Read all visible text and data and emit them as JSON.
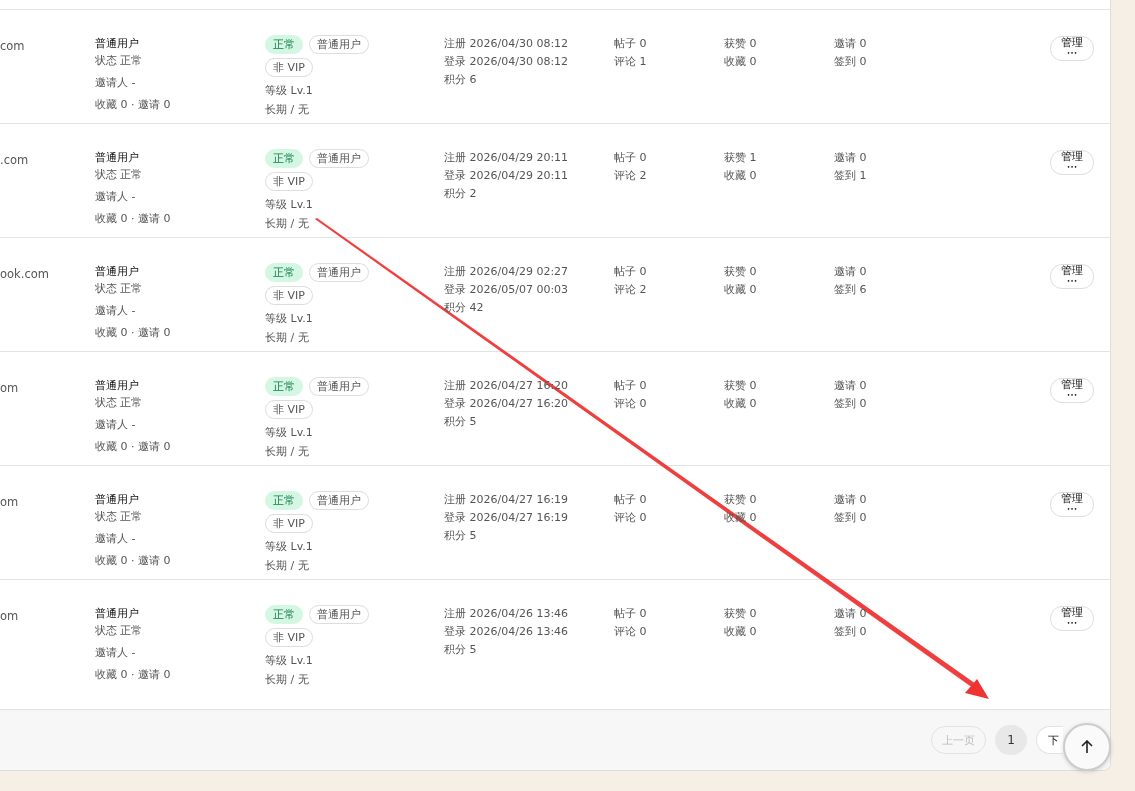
{
  "users": [
    {
      "email": "com",
      "role": "普通用户",
      "status_line": "状态 正常",
      "inviter": "邀请人 -",
      "counts": "收藏 0 · 邀请 0",
      "status_badge": "正常",
      "role_badge": "普通用户",
      "vip_badge": "非 VIP",
      "level": "等级 Lv.1",
      "term": "长期 / 无",
      "registered": "注册 2026/04/30 08:12",
      "login": "登录 2026/04/30 08:12",
      "points": "积分 6",
      "posts": "帖子 0",
      "comments": "评论 1",
      "likes": "获赞 0",
      "favorites": "收藏 0",
      "invites": "邀请 0",
      "checkins": "签到 0",
      "manage": "管理",
      "more": "•••"
    },
    {
      "email": ".com",
      "role": "普通用户",
      "status_line": "状态 正常",
      "inviter": "邀请人 -",
      "counts": "收藏 0 · 邀请 0",
      "status_badge": "正常",
      "role_badge": "普通用户",
      "vip_badge": "非 VIP",
      "level": "等级 Lv.1",
      "term": "长期 / 无",
      "registered": "注册 2026/04/29 20:11",
      "login": "登录 2026/04/29 20:11",
      "points": "积分 2",
      "posts": "帖子 0",
      "comments": "评论 2",
      "likes": "获赞 1",
      "favorites": "收藏 0",
      "invites": "邀请 0",
      "checkins": "签到 1",
      "manage": "管理",
      "more": "•••"
    },
    {
      "email": "ook.com",
      "role": "普通用户",
      "status_line": "状态 正常",
      "inviter": "邀请人 -",
      "counts": "收藏 0 · 邀请 0",
      "status_badge": "正常",
      "role_badge": "普通用户",
      "vip_badge": "非 VIP",
      "level": "等级 Lv.1",
      "term": "长期 / 无",
      "registered": "注册 2026/04/29 02:27",
      "login": "登录 2026/05/07 00:03",
      "points": "积分 42",
      "posts": "帖子 0",
      "comments": "评论 2",
      "likes": "获赞 0",
      "favorites": "收藏 0",
      "invites": "邀请 0",
      "checkins": "签到 6",
      "manage": "管理",
      "more": "•••"
    },
    {
      "email": "om",
      "role": "普通用户",
      "status_line": "状态 正常",
      "inviter": "邀请人 -",
      "counts": "收藏 0 · 邀请 0",
      "status_badge": "正常",
      "role_badge": "普通用户",
      "vip_badge": "非 VIP",
      "level": "等级 Lv.1",
      "term": "长期 / 无",
      "registered": "注册 2026/04/27 16:20",
      "login": "登录 2026/04/27 16:20",
      "points": "积分 5",
      "posts": "帖子 0",
      "comments": "评论 0",
      "likes": "获赞 0",
      "favorites": "收藏 0",
      "invites": "邀请 0",
      "checkins": "签到 0",
      "manage": "管理",
      "more": "•••"
    },
    {
      "email": "om",
      "role": "普通用户",
      "status_line": "状态 正常",
      "inviter": "邀请人 -",
      "counts": "收藏 0 · 邀请 0",
      "status_badge": "正常",
      "role_badge": "普通用户",
      "vip_badge": "非 VIP",
      "level": "等级 Lv.1",
      "term": "长期 / 无",
      "registered": "注册 2026/04/27 16:19",
      "login": "登录 2026/04/27 16:19",
      "points": "积分 5",
      "posts": "帖子 0",
      "comments": "评论 0",
      "likes": "获赞 0",
      "favorites": "收藏 0",
      "invites": "邀请 0",
      "checkins": "签到 0",
      "manage": "管理",
      "more": "•••"
    },
    {
      "email": "om",
      "role": "普通用户",
      "status_line": "状态 正常",
      "inviter": "邀请人 -",
      "counts": "收藏 0 · 邀请 0",
      "status_badge": "正常",
      "role_badge": "普通用户",
      "vip_badge": "非 VIP",
      "level": "等级 Lv.1",
      "term": "长期 / 无",
      "registered": "注册 2026/04/26 13:46",
      "login": "登录 2026/04/26 13:46",
      "points": "积分 5",
      "posts": "帖子 0",
      "comments": "评论 0",
      "likes": "获赞 0",
      "favorites": "收藏 0",
      "invites": "邀请 0",
      "checkins": "签到 0",
      "manage": "管理",
      "more": "•••"
    }
  ],
  "pagination": {
    "prev": {
      "label": "上一页",
      "disabled": true
    },
    "pages": [
      {
        "label": "1",
        "selected": true
      }
    ],
    "next": {
      "label": "下",
      "disabled": false
    }
  }
}
